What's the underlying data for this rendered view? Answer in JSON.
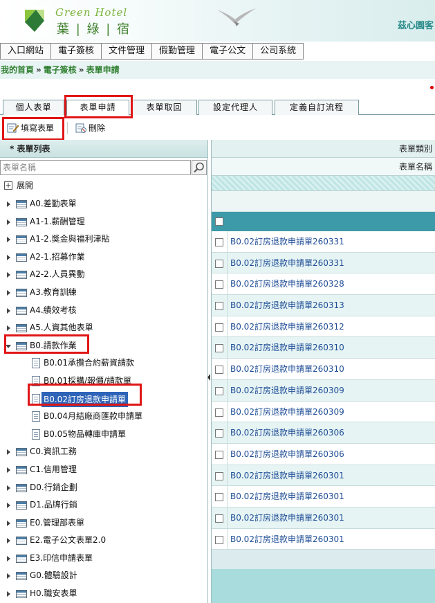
{
  "header": {
    "logo_en": "Green Hotel",
    "logo_zh": "葉 | 綠 | 宿",
    "right_text": "茲心園客"
  },
  "topmenu": {
    "items": [
      "入口網站",
      "電子簽核",
      "文件管理",
      "假勤管理",
      "電子公文",
      "公司系統"
    ]
  },
  "breadcrumb": {
    "home": "我的首頁",
    "sep": "»",
    "level1": "電子簽核",
    "level2": "表單申請"
  },
  "tabs": {
    "items": [
      "個人表單",
      "表單申請",
      "表單取回",
      "設定代理人",
      "定義自訂流程"
    ],
    "active": "表單申請"
  },
  "toolbar": {
    "fill_label": "填寫表單",
    "delete_label": "刪除"
  },
  "left": {
    "title": "* 表單列表",
    "search_placeholder": "表單名稱",
    "expand_label": "展開",
    "tree": [
      {
        "label": "A0.差勤表單"
      },
      {
        "label": "A1-1.薪酬管理"
      },
      {
        "label": "A1-2.獎金與福利津貼"
      },
      {
        "label": "A2-1.招募作業"
      },
      {
        "label": "A2-2.人員異動"
      },
      {
        "label": "A3.教育訓練"
      },
      {
        "label": "A4.績效考核"
      },
      {
        "label": "A5.人資其他表單"
      },
      {
        "label": "B0.請款作業"
      }
    ],
    "children": [
      {
        "label": "B0.01承攬合約薪資請款"
      },
      {
        "label": "B0.01採購/報價/請款單"
      },
      {
        "label": "B0.02訂房退款申請單"
      },
      {
        "label": "B0.04月結廠商匯款申請單"
      },
      {
        "label": "B0.05物品轉庫申請單"
      }
    ],
    "tree_after": [
      {
        "label": "C0.資訊工務"
      },
      {
        "label": "C1.信用管理"
      },
      {
        "label": "D0.行銷企劃"
      },
      {
        "label": "D1.品牌行銷"
      },
      {
        "label": "E0.管理部表單"
      },
      {
        "label": "E2.電子公文表單2.0"
      },
      {
        "label": "E3.印信申請表單"
      },
      {
        "label": "G0.體驗設計"
      },
      {
        "label": "H0.職安表單"
      }
    ]
  },
  "right": {
    "category_label": "表單類別",
    "name_label": "表單名稱",
    "rows": [
      "B0.02訂房退款申請單260331",
      "B0.02訂房退款申請單260331",
      "B0.02訂房退款申請單260328",
      "B0.02訂房退款申請單260313",
      "B0.02訂房退款申請單260312",
      "B0.02訂房退款申請單260310",
      "B0.02訂房退款申請單260310",
      "B0.02訂房退款申請單260309",
      "B0.02訂房退款申請單260309",
      "B0.02訂房退款申請單260306",
      "B0.02訂房退款申請單260306",
      "B0.02訂房退款申請單260301",
      "B0.02訂房退款申請單260301",
      "B0.02訂房退款申請單260301",
      "B0.02訂房退款申請單260301"
    ]
  },
  "colors": {
    "accent_teal": "#3d9aa8",
    "breadcrumb_green": "#2f7f2f",
    "highlight_red": "#e01515",
    "selected_blue": "#2d64b8"
  }
}
